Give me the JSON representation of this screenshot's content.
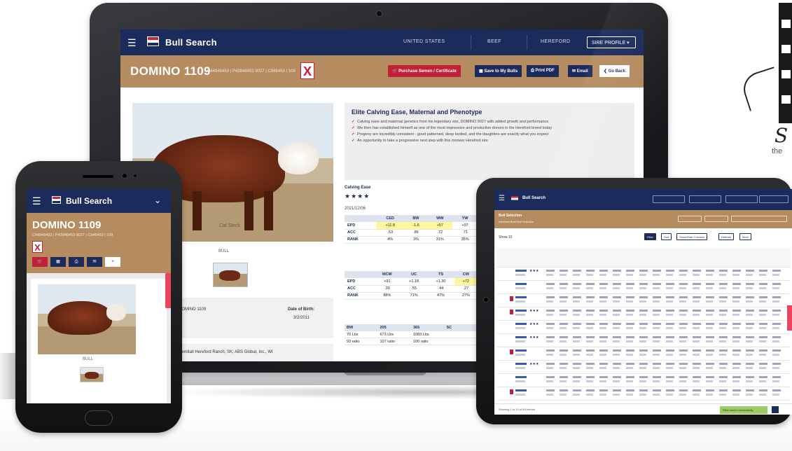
{
  "laptop": {
    "app_title": "Bull Search",
    "nav_items": [
      "UNITED STATES",
      "BEEF",
      "HEREFORD"
    ],
    "nav_dropdown": "SIRE PROFILE",
    "animal_name": "DOMINO 1109",
    "registration": "C44948453 | P43848453 9027 | C948453 | 109",
    "buttons": {
      "purchase": "Purchase Semen / Certificate",
      "save": "Save to My Bulls",
      "print": "Print PDF",
      "email": "Email",
      "back": "Go Back"
    },
    "headline": "Elite Calving Ease, Maternal and Phenotype",
    "bullets": [
      "Calving ease and maternal genetics from his legendary sire, DOMINO 9027 with added growth and performance",
      "We then has established himself as one of the most impressive and productive donors in the Hereford breed today",
      "Progeny are incredibly consistent - good patterned, deep bodied, and the daughters are exactly what you expect",
      "An opportunity to take a progressive next step with this moneer Hereford sire"
    ],
    "photo_caption": "BULL",
    "photo_signature": "Cal Stock",
    "reg_line": "DOMINO 1109",
    "dob_label": "Date of Birth:",
    "dob_value": "3/2/2011",
    "owner": "Remitall Hereford Ranch, SK; ABS Global, Inc., WI",
    "calving_ease_label": "Calving Ease",
    "calving_ease_stars": "★★★★",
    "epd_date": "2021/12/06",
    "table1": {
      "headers": [
        "",
        "CED",
        "BW",
        "WW",
        "YW"
      ],
      "rows": [
        [
          "EPD",
          "+11.8",
          "-1.6",
          "+57",
          "+97"
        ],
        [
          "ACC",
          ".53",
          ".86",
          ".72",
          ".71"
        ],
        [
          "RANK",
          "4%",
          "3%",
          "31%",
          "35%"
        ]
      ]
    },
    "table2": {
      "headers": [
        "",
        "MCW",
        "UC",
        "TS",
        "CW"
      ],
      "rows": [
        [
          "EPD",
          "+91",
          "+1.18",
          "+1.30",
          "+72"
        ],
        [
          "ACC",
          ".39",
          ".55",
          ".44",
          ".27"
        ],
        [
          "RANK",
          "88%",
          "71%",
          "47%",
          "27%"
        ]
      ]
    },
    "table3": {
      "headers": [
        "BW",
        "205",
        "365",
        "SC"
      ],
      "rows": [
        [
          "70 Lbs",
          "673 Lbs",
          "1083 Lbs",
          ""
        ],
        [
          "93 ratio",
          "107 ratio",
          "100 ratio",
          ""
        ]
      ]
    }
  },
  "phone": {
    "app_title": "Bull Search",
    "animal_name": "DOMINO 1109",
    "registration": "C44948453 | P43848453 9027 | C948453 | 109",
    "photo_caption": "BULL",
    "action_icons": [
      "cart-icon",
      "save-icon",
      "print-icon",
      "email-icon",
      "add-icon"
    ]
  },
  "tablet": {
    "app_title": "Bull Search",
    "header_title": "Bull Selection",
    "header_sub": "Hereford  Beef  Bull Selection",
    "show_label": "Show 10",
    "toolbar": [
      "Filter",
      "Sort",
      "Show/Hide Columns",
      "Refresh",
      "More"
    ],
    "footer": "Showing 1 to 10 of 84 entries",
    "toast": "Filter saved successfully"
  },
  "colors": {
    "navy": "#1b2b5c",
    "tan": "#b58b60",
    "red": "#c22038",
    "highlight": "#fff79a",
    "pink_tab": "#e94460",
    "toast_green": "#9ccc65"
  }
}
